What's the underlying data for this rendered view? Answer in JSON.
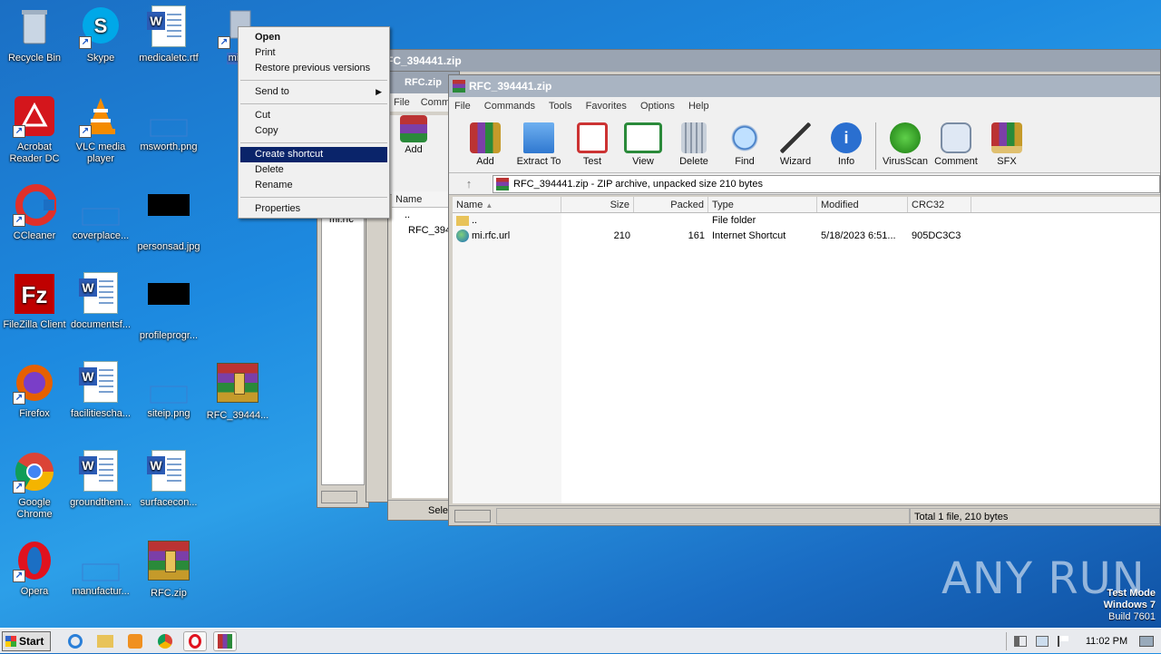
{
  "desktop_icons": {
    "recycle_bin": "Recycle Bin",
    "skype": "Skype",
    "medicaletc": "medicaletc.rtf",
    "mi_partial": "mi.",
    "acrobat": "Acrobat Reader DC",
    "vlc": "VLC media player",
    "msworth": "msworth.png",
    "ccleaner": "CCleaner",
    "coverplace": "coverplace...",
    "personsad": "personsad.jpg",
    "filezilla": "FileZilla Client",
    "documentsf": "documentsf...",
    "profileprogr": "profileprogr...",
    "firefox": "Firefox",
    "facilitiescha": "facilitiescha...",
    "siteip": "siteip.png",
    "rfc_394441_short": "RFC_39444...",
    "chrome": "Google Chrome",
    "groundthem": "groundthem...",
    "surfacecon": "surfacecon...",
    "opera": "Opera",
    "manufactur": "manufactur...",
    "rfc_zip": "RFC.zip"
  },
  "context_menu": {
    "open": "Open",
    "print": "Print",
    "restore": "Restore previous versions",
    "send_to": "Send to",
    "cut": "Cut",
    "copy": "Copy",
    "create_shortcut": "Create shortcut",
    "delete": "Delete",
    "rename": "Rename",
    "properties": "Properties"
  },
  "back_windows": {
    "outer_title": "FC_394441.zip",
    "middle_title": "RFC.zip",
    "middle_menu_file": "File",
    "middle_menu_commands": "Comma",
    "middle_add": "Add",
    "middle_col_name": "Name",
    "middle_row_up": "..",
    "middle_row_file": "RFC_394",
    "middle_status": "Sele",
    "left_row": "mi.rfc"
  },
  "winrar": {
    "title": "RFC_394441.zip",
    "menu": [
      "File",
      "Commands",
      "Tools",
      "Favorites",
      "Options",
      "Help"
    ],
    "toolbar": [
      "Add",
      "Extract To",
      "Test",
      "View",
      "Delete",
      "Find",
      "Wizard",
      "Info",
      "VirusScan",
      "Comment",
      "SFX"
    ],
    "address": "RFC_394441.zip - ZIP archive, unpacked size 210 bytes",
    "columns": [
      "Name",
      "Size",
      "Packed",
      "Type",
      "Modified",
      "CRC32"
    ],
    "rows": [
      {
        "name": "..",
        "size": "",
        "packed": "",
        "type": "File folder",
        "modified": "",
        "crc": ""
      },
      {
        "name": "mi.rfc.url",
        "size": "210",
        "packed": "161",
        "type": "Internet Shortcut",
        "modified": "5/18/2023 6:51...",
        "crc": "905DC3C3"
      }
    ],
    "status": "Total 1 file, 210 bytes"
  },
  "taskbar": {
    "start": "Start",
    "clock": "11:02 PM"
  },
  "watermark": {
    "brand": "ANY RUN",
    "mode": "Test Mode",
    "os": "Windows 7",
    "build": "Build 7601"
  }
}
